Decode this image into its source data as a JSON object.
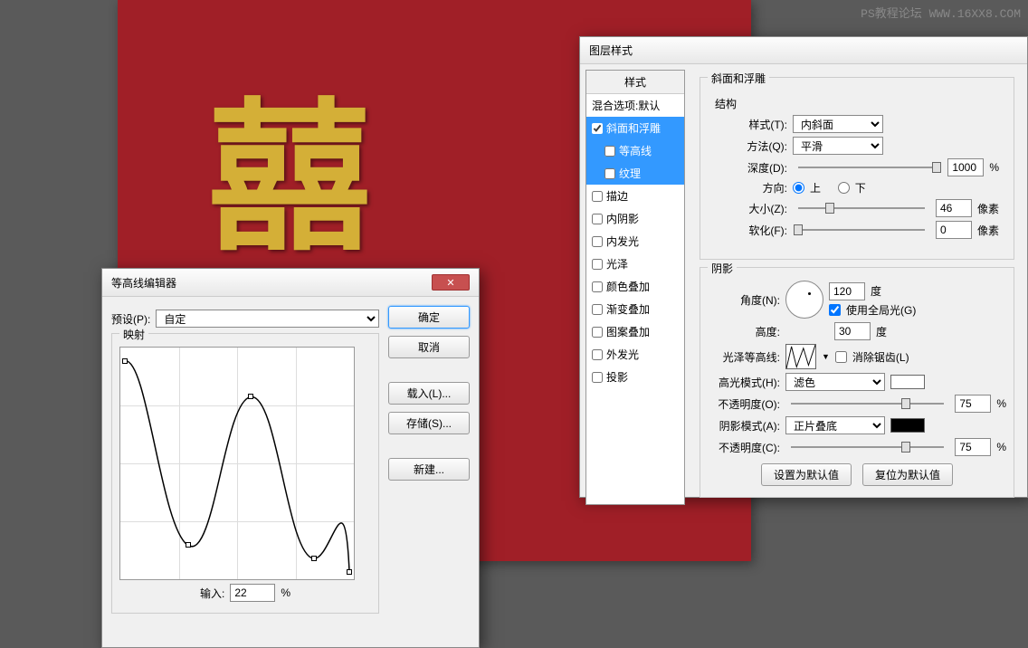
{
  "watermark": "PS教程论坛 WWW.16XX8.COM",
  "canvas_text": "囍",
  "layerStyle": {
    "title": "图层样式",
    "list": {
      "header": "样式",
      "blending": "混合选项:默认",
      "items": [
        {
          "label": "斜面和浮雕",
          "checked": true,
          "sel": true
        },
        {
          "label": "等高线",
          "checked": false,
          "sub": true,
          "sel": true
        },
        {
          "label": "纹理",
          "checked": false,
          "sub": true,
          "sel": true
        },
        {
          "label": "描边",
          "checked": false
        },
        {
          "label": "内阴影",
          "checked": false
        },
        {
          "label": "内发光",
          "checked": false
        },
        {
          "label": "光泽",
          "checked": false
        },
        {
          "label": "颜色叠加",
          "checked": false
        },
        {
          "label": "渐变叠加",
          "checked": false
        },
        {
          "label": "图案叠加",
          "checked": false
        },
        {
          "label": "外发光",
          "checked": false
        },
        {
          "label": "投影",
          "checked": false
        }
      ]
    },
    "bevel": {
      "section": "斜面和浮雕",
      "structure": "结构",
      "style_lbl": "样式(T):",
      "style_val": "内斜面",
      "technique_lbl": "方法(Q):",
      "technique_val": "平滑",
      "depth_lbl": "深度(D):",
      "depth_val": "1000",
      "pct": "%",
      "direction_lbl": "方向:",
      "up": "上",
      "down": "下",
      "size_lbl": "大小(Z):",
      "size_val": "46",
      "px": "像素",
      "soften_lbl": "软化(F):",
      "soften_val": "0",
      "shading": "阴影",
      "angle_lbl": "角度(N):",
      "angle_val": "120",
      "deg": "度",
      "global": "使用全局光(G)",
      "altitude_lbl": "高度:",
      "altitude_val": "30",
      "gloss_lbl": "光泽等高线:",
      "antialias": "消除锯齿(L)",
      "hl_mode_lbl": "高光模式(H):",
      "hl_mode_val": "滤色",
      "opacity_lbl": "不透明度(O):",
      "hl_opacity": "75",
      "sh_mode_lbl": "阴影模式(A):",
      "sh_mode_val": "正片叠底",
      "sh_opacity_lbl": "不透明度(C):",
      "sh_opacity": "75",
      "make_default": "设置为默认值",
      "reset_default": "复位为默认值"
    }
  },
  "contourEditor": {
    "title": "等高线编辑器",
    "preset_lbl": "预设(P):",
    "preset_val": "自定",
    "mapping": "映射",
    "ok": "确定",
    "cancel": "取消",
    "load": "载入(L)...",
    "save": "存储(S)...",
    "new": "新建...",
    "input_lbl": "输入:",
    "input_val": "22",
    "pct": "%"
  }
}
